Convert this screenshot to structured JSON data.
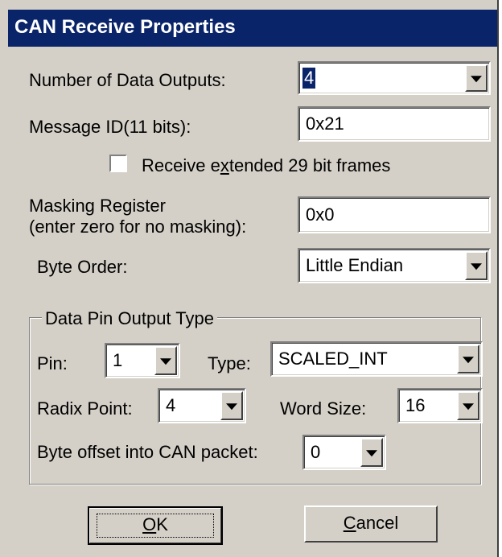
{
  "window": {
    "title": "CAN Receive Properties"
  },
  "form": {
    "num_outputs": {
      "label": "Number of Data Outputs:",
      "value": "4"
    },
    "message_id": {
      "label": "Message ID(11 bits):",
      "value": "0x21"
    },
    "extended_frames": {
      "label_before": "Receive e",
      "label_accel": "x",
      "label_after": "tended 29 bit frames",
      "checked": false
    },
    "masking": {
      "label_line1": "Masking Register",
      "label_line2": "(enter zero for no masking):",
      "value": "0x0"
    },
    "byte_order": {
      "label": "Byte Order:",
      "value": "Little Endian"
    }
  },
  "group": {
    "legend": "Data Pin Output Type",
    "pin": {
      "label": "Pin:",
      "value": "1"
    },
    "type": {
      "label": "Type:",
      "value": "SCALED_INT"
    },
    "radix": {
      "label": "Radix Point:",
      "value": "4"
    },
    "word_size": {
      "label": "Word Size:",
      "value": "16"
    },
    "byte_offset": {
      "label": "Byte offset into CAN packet:",
      "value": "0"
    }
  },
  "buttons": {
    "ok": {
      "accel": "O",
      "rest": "K"
    },
    "cancel": {
      "accel": "C",
      "rest": "ancel"
    }
  }
}
